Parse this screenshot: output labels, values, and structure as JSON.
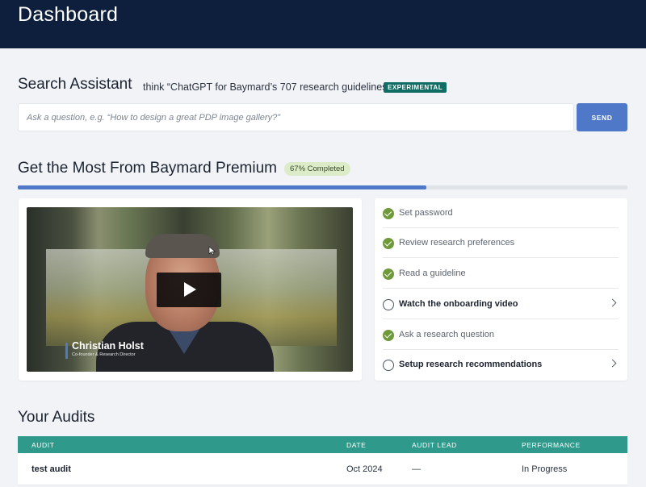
{
  "header": {
    "title": "Dashboard"
  },
  "search_assistant": {
    "title": "Search Assistant",
    "tagline": "think “ChatGPT for Baymard’s 707 research guidelines”",
    "badge": "EXPERIMENTAL",
    "placeholder": "Ask a question, e.g. “How to design a great PDP image gallery?”",
    "send_label": "SEND"
  },
  "premium": {
    "title": "Get the Most From Baymard Premium",
    "progress_label": "67% Completed",
    "progress_fraction": 0.67,
    "video": {
      "speaker_name": "Christian Holst",
      "speaker_role": "Co-founder & Research Director"
    },
    "checklist": [
      {
        "label": "Set password",
        "done": true
      },
      {
        "label": "Review research preferences",
        "done": true
      },
      {
        "label": "Read a guideline",
        "done": true
      },
      {
        "label": "Watch the onboarding video",
        "done": false
      },
      {
        "label": "Ask a research question",
        "done": true
      },
      {
        "label": "Setup research recommendations",
        "done": false
      }
    ]
  },
  "audits": {
    "title": "Your Audits",
    "columns": [
      "AUDIT",
      "DATE",
      "AUDIT LEAD",
      "PERFORMANCE"
    ],
    "rows": [
      {
        "audit": "test audit",
        "date": "Oct 2024",
        "lead": "—",
        "performance": "In Progress"
      }
    ]
  },
  "colors": {
    "topbar": "#0d1f3c",
    "accent": "#4f79c8",
    "table_header": "#2f9a8c",
    "done": "#6f9a3a"
  }
}
